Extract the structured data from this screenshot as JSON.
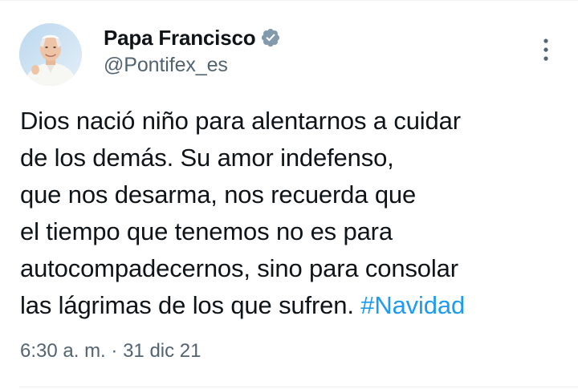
{
  "author": {
    "display_name": "Papa Francisco",
    "handle": "@Pontifex_es",
    "verified": true,
    "avatar_icon": "portrait-avatar"
  },
  "tweet": {
    "lines": [
      "Dios nació niño para alentarnos a cuidar",
      "de los demás. Su amor indefenso,",
      "que nos desarma, nos recuerda que",
      "el tiempo que tenemos no es para",
      "autocompadecernos, sino para consolar",
      "las lágrimas de los que sufren. "
    ],
    "hashtag": "#Navidad",
    "time": "6:30 a. m.",
    "separator": "·",
    "date": "31 dic 21"
  },
  "colors": {
    "text": "#0f1419",
    "secondary": "#536471",
    "link": "#1d9bf0",
    "verified_badge": "#829aab"
  },
  "icons": {
    "verified": "verified-badge-icon",
    "more": "more-vertical-icon"
  }
}
